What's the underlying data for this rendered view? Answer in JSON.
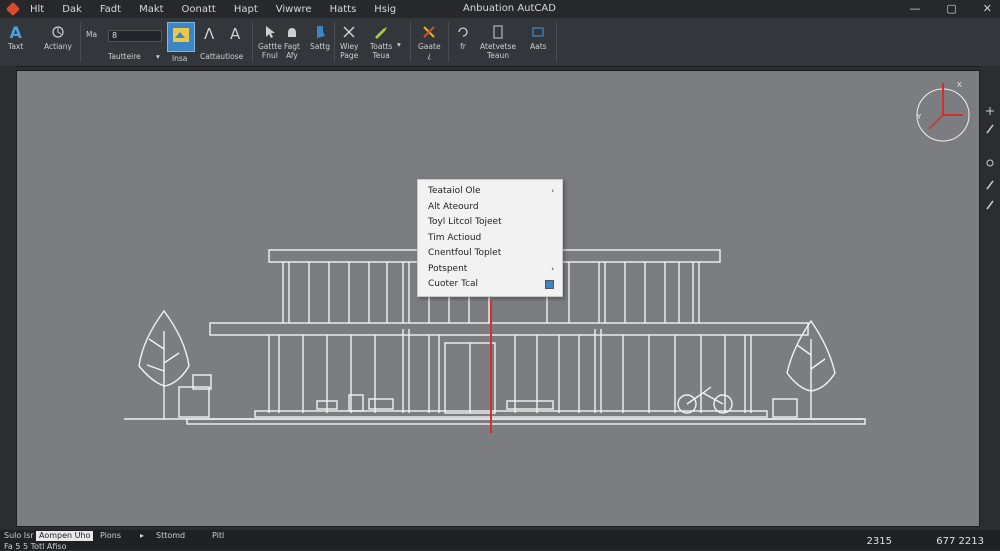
{
  "menubar": {
    "items": [
      "Hlt",
      "Dak",
      "Fadt",
      "Makt",
      "Oonatt",
      "Hapt",
      "Viwwre",
      "Hatts",
      "Hsig"
    ],
    "title": "Anbuation AutCAD",
    "win": [
      "—",
      "▢",
      "✕"
    ]
  },
  "ribbon": {
    "text_tool": "Taxt",
    "actions": "Actiany",
    "size_label": "Ma",
    "size_value": "8",
    "group_text": "Tautteire",
    "group_x": "lnsa",
    "group_constructions": "Cattautiose",
    "tools": [
      {
        "label": "Gattte\nFnuI"
      },
      {
        "label": "Fagt\nAfy"
      },
      {
        "label": "Sattg"
      },
      {
        "label": "Wiey\nPage"
      },
      {
        "label": "Toatts\nTeua"
      },
      {
        "label": "Gaate\n¿"
      },
      {
        "label": "fr"
      },
      {
        "label": "Atetvetse\nTeaun"
      },
      {
        "label": "Aats"
      }
    ]
  },
  "context_menu": {
    "items": [
      {
        "label": "Teataiol Ole",
        "arrow": "›"
      },
      {
        "label": "Alt Ateourd",
        "arrow": ""
      },
      {
        "label": "Toyl Litcol Tojeet",
        "arrow": ""
      },
      {
        "label": "Tim Actioud",
        "arrow": ""
      },
      {
        "label": "Cnentfoul Toplet",
        "arrow": ""
      },
      {
        "label": "Potspent",
        "arrow": "›"
      },
      {
        "label": "Cuoter Tcal",
        "arrow": ""
      }
    ]
  },
  "status": {
    "tab1": "Sulo Isr",
    "tab2": "Aompen Uho",
    "tab3": "Pions",
    "tab4": "Sttomd",
    "tab5": "Pitl",
    "lower": "Fa  5  5  Totl   Afiso",
    "coord1": "2315",
    "coord2": "677  2213"
  }
}
